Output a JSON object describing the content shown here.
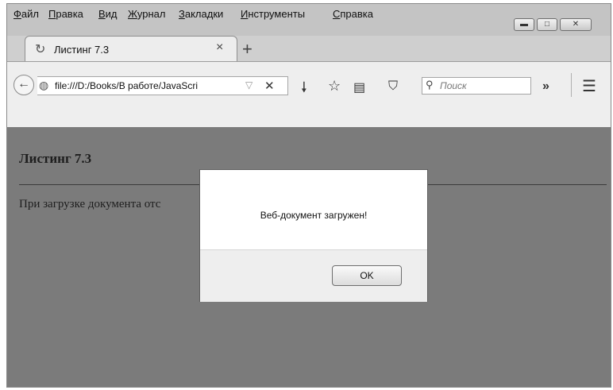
{
  "menu": [
    "Файл",
    "Правка",
    "Вид",
    "Журнал",
    "Закладки",
    "Инструменты",
    "Справка"
  ],
  "window_buttons": {
    "minimize_icon": "minimize-icon",
    "maximize_icon": "maximize-icon",
    "close_icon": "close-icon"
  },
  "tab": {
    "title": "Листинг 7.3",
    "close_glyph": "×",
    "new_tab_glyph": "+"
  },
  "url": {
    "value": "file:///D:/Books/В работе/JavaScri"
  },
  "search": {
    "placeholder": "Поиск"
  },
  "navbar_overflow": "»",
  "page": {
    "heading": "Листинг 7.3",
    "body_text": "При загрузке документа отс"
  },
  "dialog": {
    "message": "Веб-документ загружен!",
    "ok_label": "OK"
  }
}
